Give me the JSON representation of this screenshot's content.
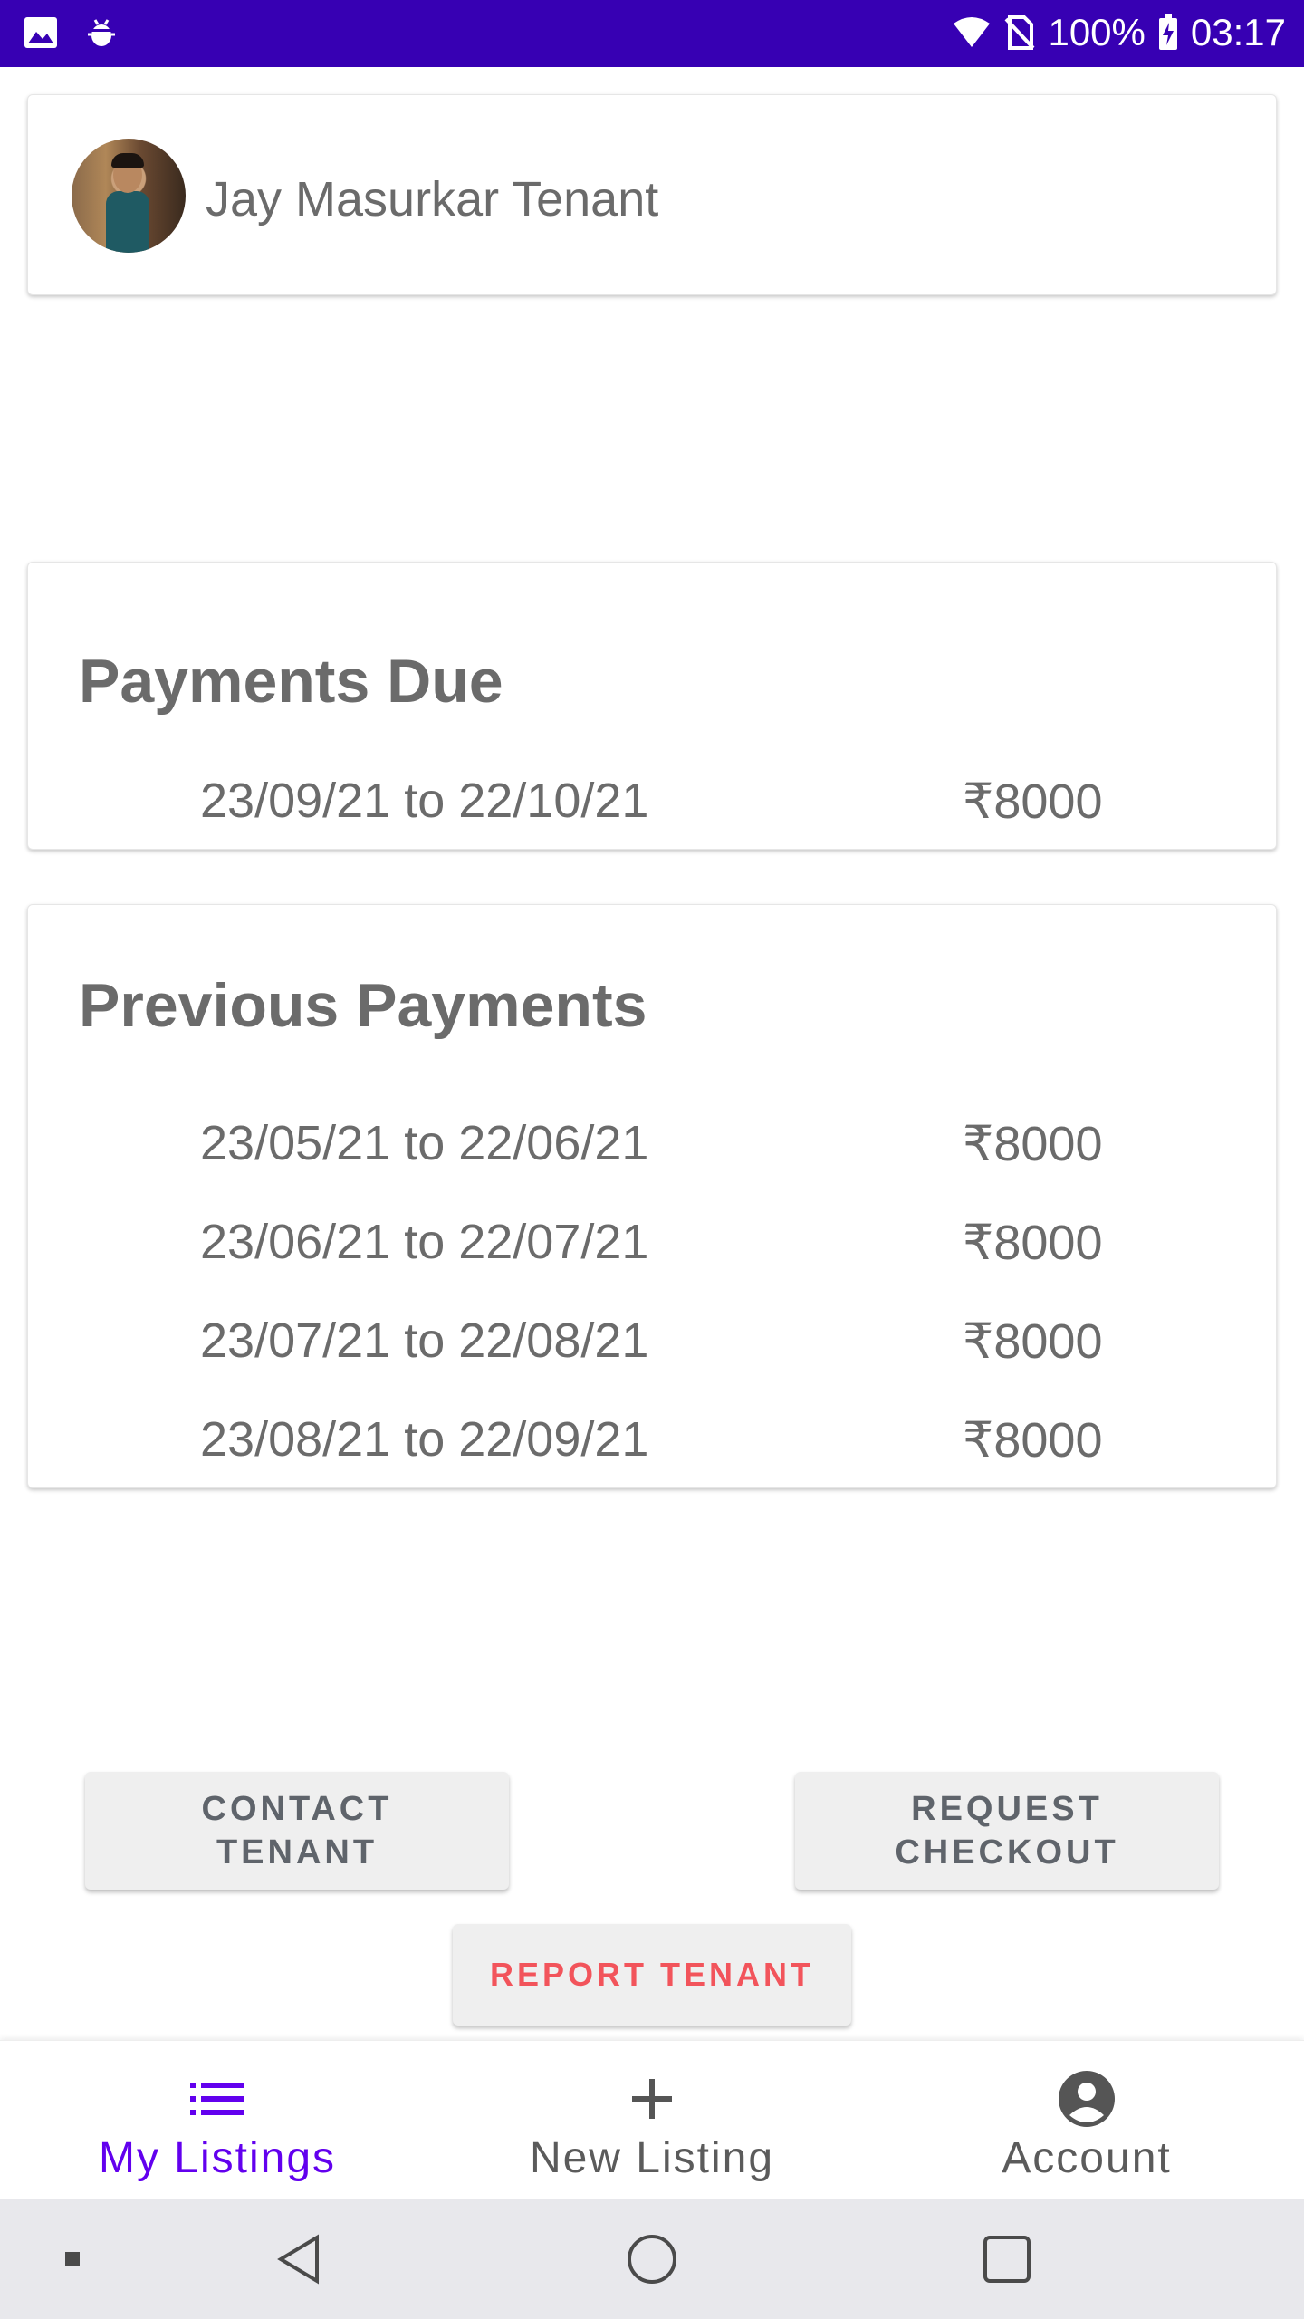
{
  "status_bar": {
    "battery": "100%",
    "time": "03:17",
    "icons": [
      "image-icon",
      "bug-icon",
      "wifi-icon",
      "no-sim-icon",
      "battery-charging-icon"
    ]
  },
  "tenant": {
    "name": "Jay Masurkar Tenant"
  },
  "payments_due": {
    "title": "Payments Due",
    "rows": [
      {
        "period": "23/09/21 to 22/10/21",
        "amount": "₹8000"
      }
    ]
  },
  "previous_payments": {
    "title": "Previous Payments",
    "rows": [
      {
        "period": "23/05/21 to 22/06/21",
        "amount": "₹8000"
      },
      {
        "period": "23/06/21 to 22/07/21",
        "amount": "₹8000"
      },
      {
        "period": "23/07/21 to 22/08/21",
        "amount": "₹8000"
      },
      {
        "period": "23/08/21 to 22/09/21",
        "amount": "₹8000"
      }
    ]
  },
  "actions": {
    "contact_line1": "CONTACT",
    "contact_line2": "TENANT",
    "checkout_line1": "REQUEST",
    "checkout_line2": "CHECKOUT",
    "report": "REPORT TENANT"
  },
  "bottom_nav": {
    "items": [
      {
        "label": "My Listings",
        "icon": "list-icon",
        "active": true
      },
      {
        "label": "New Listing",
        "icon": "plus-icon",
        "active": false
      },
      {
        "label": "Account",
        "icon": "account-circle-icon",
        "active": false
      }
    ]
  },
  "colors": {
    "status_bar": "#3700b3",
    "accent": "#6200ee",
    "report_text": "#f2545b",
    "text_gray": "#6b6b6b"
  }
}
